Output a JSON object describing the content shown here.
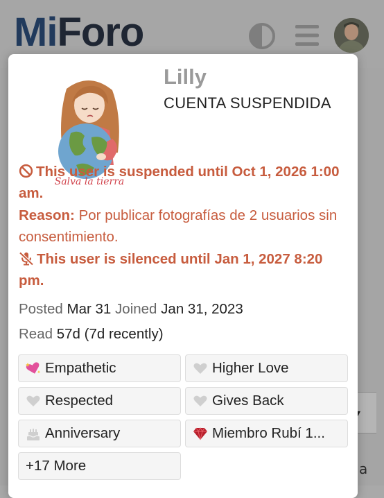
{
  "header": {
    "logo_text": "MiForo",
    "theme_toggle_icon": "half-circle-icon",
    "menu_icon": "hamburger-icon",
    "accent_color": "#213a5c"
  },
  "card": {
    "username": "Lilly",
    "title": "CUENTA SUSPENDIDA",
    "avatar_caption": "Salva la tierra",
    "suspended": {
      "icon": "ban-icon",
      "text": "This user is suspended until Oct 1, 2026 1:00 am."
    },
    "reason": {
      "label": "Reason:",
      "text": "Por publicar fotografías de 2 usuarios sin consentimiento."
    },
    "silenced": {
      "icon": "microphone-slash-icon",
      "text": "This user is silenced until Jan 1, 2027 8:20 pm."
    },
    "alert_color": "#c75c3e",
    "posted_label": "Posted",
    "posted_value": "Mar 31",
    "joined_label": "Joined",
    "joined_value": "Jan 31, 2023",
    "read_label": "Read",
    "read_value": "57d (7d recently)",
    "badges": [
      {
        "label": "Empathetic",
        "icon": "sparkling-heart-icon"
      },
      {
        "label": "Higher Love",
        "icon": "heart-icon"
      },
      {
        "label": "Respected",
        "icon": "heart-icon"
      },
      {
        "label": "Gives Back",
        "icon": "heart-icon"
      },
      {
        "label": "Anniversary",
        "icon": "cake-icon"
      },
      {
        "label": "Miembro Rubí 1...",
        "icon": "gem-icon"
      },
      {
        "label": "+17 More"
      }
    ]
  },
  "background": {
    "partial_letter": "a",
    "dropdown_caret": "▾"
  }
}
